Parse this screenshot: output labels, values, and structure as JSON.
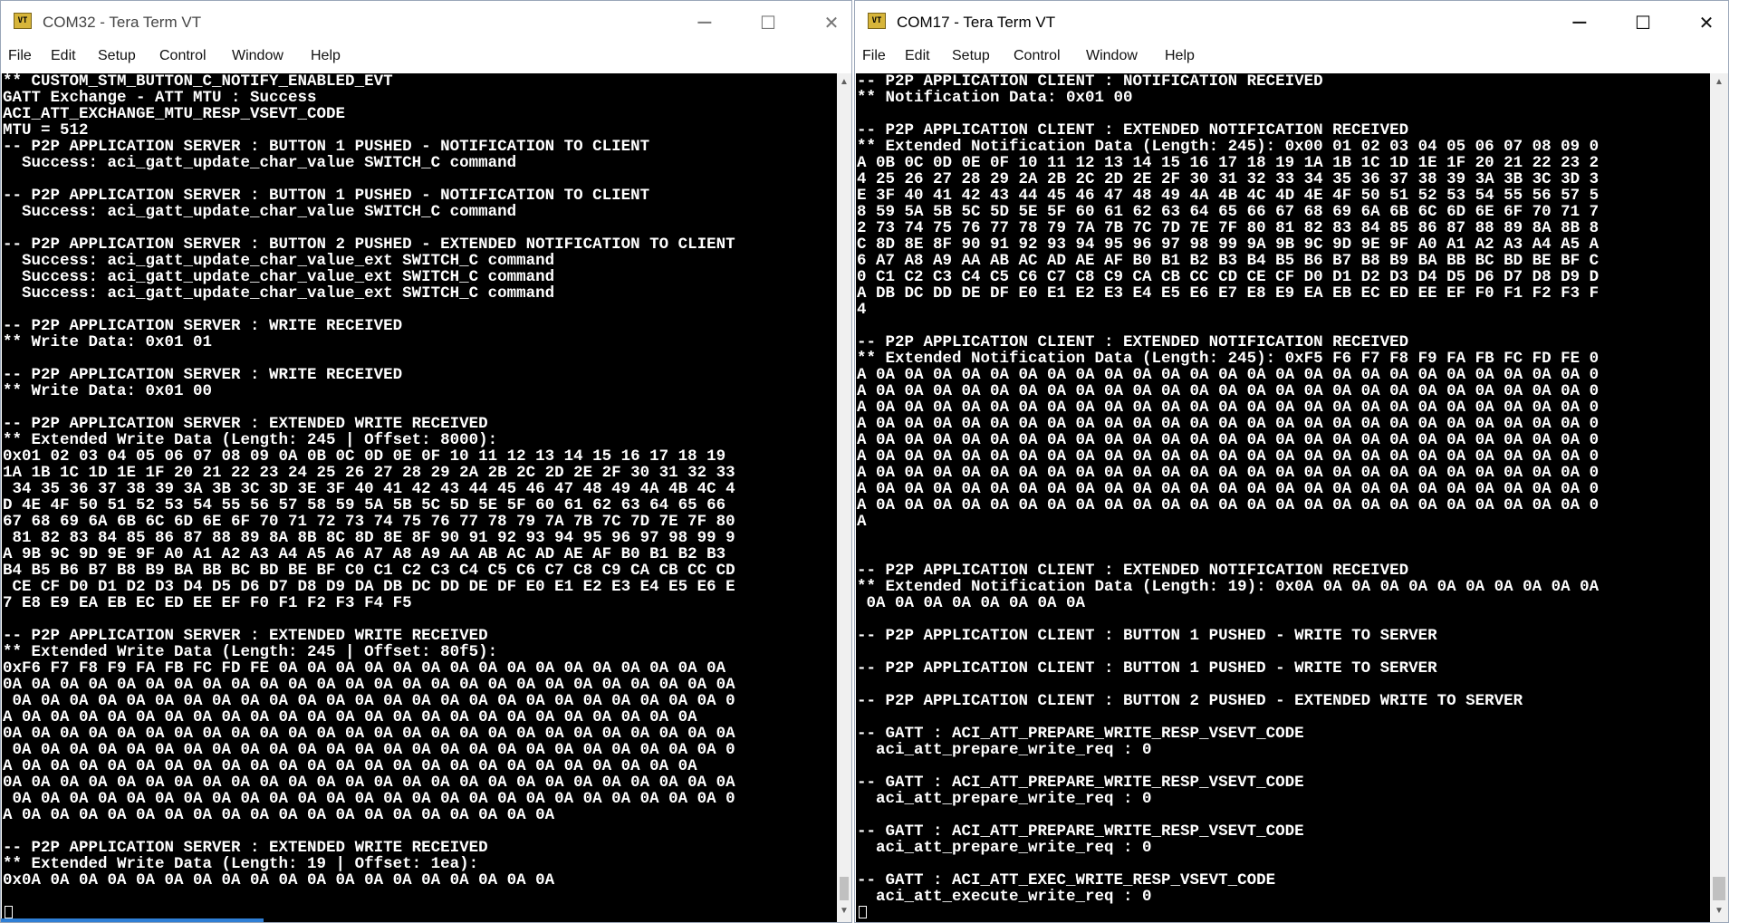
{
  "colors": {
    "terminal_bg": "#000000",
    "terminal_fg": "#ffffff",
    "titlebar_bg": "#ffffff",
    "app_icon": "#d7b53a"
  },
  "icons": {
    "app": "tera-term-vt-icon",
    "minimize": "minimize-icon",
    "maximize": "maximize-icon",
    "close": "close-icon"
  },
  "left": {
    "title": "COM32 - Tera Term VT",
    "icon_text": "VT",
    "controls": {
      "minimize": "─",
      "maximize": "☐",
      "close": "✕"
    },
    "menu": [
      "File",
      "Edit",
      "Setup",
      "Control",
      "Window",
      "Help"
    ],
    "scroll_up": "▲",
    "scroll_down": "▼",
    "lines": [
      "** CUSTOM_STM_BUTTON_C_NOTIFY_ENABLED_EVT",
      "GATT Exchange - ATT MTU : Success",
      "ACI_ATT_EXCHANGE_MTU_RESP_VSEVT_CODE",
      "MTU = 512",
      "-- P2P APPLICATION SERVER : BUTTON 1 PUSHED - NOTIFICATION TO CLIENT",
      "  Success: aci_gatt_update_char_value SWITCH_C command",
      "",
      "-- P2P APPLICATION SERVER : BUTTON 1 PUSHED - NOTIFICATION TO CLIENT",
      "  Success: aci_gatt_update_char_value SWITCH_C command",
      "",
      "-- P2P APPLICATION SERVER : BUTTON 2 PUSHED - EXTENDED NOTIFICATION TO CLIENT",
      "  Success: aci_gatt_update_char_value_ext SWITCH_C command",
      "  Success: aci_gatt_update_char_value_ext SWITCH_C command",
      "  Success: aci_gatt_update_char_value_ext SWITCH_C command",
      "",
      "-- P2P APPLICATION SERVER : WRITE RECEIVED",
      "** Write Data: 0x01 01",
      "",
      "-- P2P APPLICATION SERVER : WRITE RECEIVED",
      "** Write Data: 0x01 00",
      "",
      "-- P2P APPLICATION SERVER : EXTENDED WRITE RECEIVED",
      "** Extended Write Data (Length: 245 | Offset: 8000):",
      "0x01 02 03 04 05 06 07 08 09 0A 0B 0C 0D 0E 0F 10 11 12 13 14 15 16 17 18 19",
      "1A 1B 1C 1D 1E 1F 20 21 22 23 24 25 26 27 28 29 2A 2B 2C 2D 2E 2F 30 31 32 33",
      " 34 35 36 37 38 39 3A 3B 3C 3D 3E 3F 40 41 42 43 44 45 46 47 48 49 4A 4B 4C 4",
      "D 4E 4F 50 51 52 53 54 55 56 57 58 59 5A 5B 5C 5D 5E 5F 60 61 62 63 64 65 66",
      "67 68 69 6A 6B 6C 6D 6E 6F 70 71 72 73 74 75 76 77 78 79 7A 7B 7C 7D 7E 7F 80",
      " 81 82 83 84 85 86 87 88 89 8A 8B 8C 8D 8E 8F 90 91 92 93 94 95 96 97 98 99 9",
      "A 9B 9C 9D 9E 9F A0 A1 A2 A3 A4 A5 A6 A7 A8 A9 AA AB AC AD AE AF B0 B1 B2 B3",
      "B4 B5 B6 B7 B8 B9 BA BB BC BD BE BF C0 C1 C2 C3 C4 C5 C6 C7 C8 C9 CA CB CC CD",
      " CE CF D0 D1 D2 D3 D4 D5 D6 D7 D8 D9 DA DB DC DD DE DF E0 E1 E2 E3 E4 E5 E6 E",
      "7 E8 E9 EA EB EC ED EE EF F0 F1 F2 F3 F4 F5",
      "",
      "-- P2P APPLICATION SERVER : EXTENDED WRITE RECEIVED",
      "** Extended Write Data (Length: 245 | Offset: 80f5):",
      "0xF6 F7 F8 F9 FA FB FC FD FE 0A 0A 0A 0A 0A 0A 0A 0A 0A 0A 0A 0A 0A 0A 0A 0A",
      "0A 0A 0A 0A 0A 0A 0A 0A 0A 0A 0A 0A 0A 0A 0A 0A 0A 0A 0A 0A 0A 0A 0A 0A 0A 0A",
      " 0A 0A 0A 0A 0A 0A 0A 0A 0A 0A 0A 0A 0A 0A 0A 0A 0A 0A 0A 0A 0A 0A 0A 0A 0A 0",
      "A 0A 0A 0A 0A 0A 0A 0A 0A 0A 0A 0A 0A 0A 0A 0A 0A 0A 0A 0A 0A 0A 0A 0A 0A",
      "0A 0A 0A 0A 0A 0A 0A 0A 0A 0A 0A 0A 0A 0A 0A 0A 0A 0A 0A 0A 0A 0A 0A 0A 0A 0A",
      " 0A 0A 0A 0A 0A 0A 0A 0A 0A 0A 0A 0A 0A 0A 0A 0A 0A 0A 0A 0A 0A 0A 0A 0A 0A 0",
      "A 0A 0A 0A 0A 0A 0A 0A 0A 0A 0A 0A 0A 0A 0A 0A 0A 0A 0A 0A 0A 0A 0A 0A 0A",
      "0A 0A 0A 0A 0A 0A 0A 0A 0A 0A 0A 0A 0A 0A 0A 0A 0A 0A 0A 0A 0A 0A 0A 0A 0A 0A",
      " 0A 0A 0A 0A 0A 0A 0A 0A 0A 0A 0A 0A 0A 0A 0A 0A 0A 0A 0A 0A 0A 0A 0A 0A 0A 0",
      "A 0A 0A 0A 0A 0A 0A 0A 0A 0A 0A 0A 0A 0A 0A 0A 0A 0A 0A 0A",
      "",
      "-- P2P APPLICATION SERVER : EXTENDED WRITE RECEIVED",
      "** Extended Write Data (Length: 19 | Offset: 1ea):",
      "0x0A 0A 0A 0A 0A 0A 0A 0A 0A 0A 0A 0A 0A 0A 0A 0A 0A 0A 0A"
    ]
  },
  "right": {
    "title": "COM17 - Tera Term VT",
    "icon_text": "VT",
    "controls": {
      "minimize": "─",
      "maximize": "☐",
      "close": "✕"
    },
    "menu": [
      "File",
      "Edit",
      "Setup",
      "Control",
      "Window",
      "Help"
    ],
    "scroll_up": "▲",
    "scroll_down": "▼",
    "lines": [
      "-- P2P APPLICATION CLIENT : NOTIFICATION RECEIVED",
      "** Notification Data: 0x01 00",
      "",
      "-- P2P APPLICATION CLIENT : EXTENDED NOTIFICATION RECEIVED",
      "** Extended Notification Data (Length: 245): 0x00 01 02 03 04 05 06 07 08 09 0",
      "A 0B 0C 0D 0E 0F 10 11 12 13 14 15 16 17 18 19 1A 1B 1C 1D 1E 1F 20 21 22 23 2",
      "4 25 26 27 28 29 2A 2B 2C 2D 2E 2F 30 31 32 33 34 35 36 37 38 39 3A 3B 3C 3D 3",
      "E 3F 40 41 42 43 44 45 46 47 48 49 4A 4B 4C 4D 4E 4F 50 51 52 53 54 55 56 57 5",
      "8 59 5A 5B 5C 5D 5E 5F 60 61 62 63 64 65 66 67 68 69 6A 6B 6C 6D 6E 6F 70 71 7",
      "2 73 74 75 76 77 78 79 7A 7B 7C 7D 7E 7F 80 81 82 83 84 85 86 87 88 89 8A 8B 8",
      "C 8D 8E 8F 90 91 92 93 94 95 96 97 98 99 9A 9B 9C 9D 9E 9F A0 A1 A2 A3 A4 A5 A",
      "6 A7 A8 A9 AA AB AC AD AE AF B0 B1 B2 B3 B4 B5 B6 B7 B8 B9 BA BB BC BD BE BF C",
      "0 C1 C2 C3 C4 C5 C6 C7 C8 C9 CA CB CC CD CE CF D0 D1 D2 D3 D4 D5 D6 D7 D8 D9 D",
      "A DB DC DD DE DF E0 E1 E2 E3 E4 E5 E6 E7 E8 E9 EA EB EC ED EE EF F0 F1 F2 F3 F",
      "4",
      "",
      "-- P2P APPLICATION CLIENT : EXTENDED NOTIFICATION RECEIVED",
      "** Extended Notification Data (Length: 245): 0xF5 F6 F7 F8 F9 FA FB FC FD FE 0",
      "A 0A 0A 0A 0A 0A 0A 0A 0A 0A 0A 0A 0A 0A 0A 0A 0A 0A 0A 0A 0A 0A 0A 0A 0A 0A 0",
      "A 0A 0A 0A 0A 0A 0A 0A 0A 0A 0A 0A 0A 0A 0A 0A 0A 0A 0A 0A 0A 0A 0A 0A 0A 0A 0",
      "A 0A 0A 0A 0A 0A 0A 0A 0A 0A 0A 0A 0A 0A 0A 0A 0A 0A 0A 0A 0A 0A 0A 0A 0A 0A 0",
      "A 0A 0A 0A 0A 0A 0A 0A 0A 0A 0A 0A 0A 0A 0A 0A 0A 0A 0A 0A 0A 0A 0A 0A 0A 0A 0",
      "A 0A 0A 0A 0A 0A 0A 0A 0A 0A 0A 0A 0A 0A 0A 0A 0A 0A 0A 0A 0A 0A 0A 0A 0A 0A 0",
      "A 0A 0A 0A 0A 0A 0A 0A 0A 0A 0A 0A 0A 0A 0A 0A 0A 0A 0A 0A 0A 0A 0A 0A 0A 0A 0",
      "A 0A 0A 0A 0A 0A 0A 0A 0A 0A 0A 0A 0A 0A 0A 0A 0A 0A 0A 0A 0A 0A 0A 0A 0A 0A 0",
      "A 0A 0A 0A 0A 0A 0A 0A 0A 0A 0A 0A 0A 0A 0A 0A 0A 0A 0A 0A 0A 0A 0A 0A 0A 0A 0",
      "A 0A 0A 0A 0A 0A 0A 0A 0A 0A 0A 0A 0A 0A 0A 0A 0A 0A 0A 0A 0A 0A 0A 0A 0A 0A 0",
      "A",
      "",
      "",
      "-- P2P APPLICATION CLIENT : EXTENDED NOTIFICATION RECEIVED",
      "** Extended Notification Data (Length: 19): 0x0A 0A 0A 0A 0A 0A 0A 0A 0A 0A 0A",
      " 0A 0A 0A 0A 0A 0A 0A 0A",
      "",
      "-- P2P APPLICATION CLIENT : BUTTON 1 PUSHED - WRITE TO SERVER",
      "",
      "-- P2P APPLICATION CLIENT : BUTTON 1 PUSHED - WRITE TO SERVER",
      "",
      "-- P2P APPLICATION CLIENT : BUTTON 2 PUSHED - EXTENDED WRITE TO SERVER",
      "",
      "-- GATT : ACI_ATT_PREPARE_WRITE_RESP_VSEVT_CODE",
      "  aci_att_prepare_write_req : 0",
      "",
      "-- GATT : ACI_ATT_PREPARE_WRITE_RESP_VSEVT_CODE",
      "  aci_att_prepare_write_req : 0",
      "",
      "-- GATT : ACI_ATT_PREPARE_WRITE_RESP_VSEVT_CODE",
      "  aci_att_prepare_write_req : 0",
      "",
      "-- GATT : ACI_ATT_EXEC_WRITE_RESP_VSEVT_CODE",
      "  aci_att_execute_write_req : 0"
    ]
  }
}
